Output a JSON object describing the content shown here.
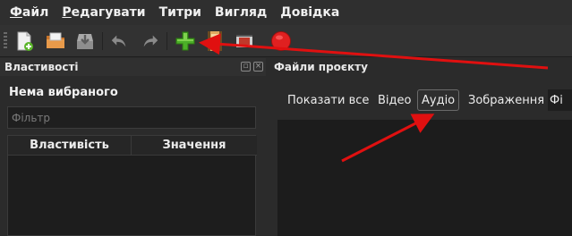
{
  "menubar": {
    "items": [
      {
        "accel": "Ф",
        "rest": "айл"
      },
      {
        "accel": "Р",
        "rest": "едагувати"
      },
      {
        "accel": "",
        "rest": "Титри"
      },
      {
        "accel": "",
        "rest": "Вигляд"
      },
      {
        "accel": "",
        "rest": "Довідка"
      }
    ]
  },
  "toolbar": {
    "icons": [
      "new-file-icon",
      "open-folder-icon",
      "save-icon",
      "undo-icon",
      "redo-icon",
      "import-files-icon",
      "film-strip-icon",
      "export-video-icon",
      "record-icon"
    ]
  },
  "properties": {
    "title": "Властивості",
    "none_selected": "Нема вибраного",
    "filter_placeholder": "Фільтр",
    "col_property": "Властивість",
    "col_value": "Значення"
  },
  "project_files": {
    "title": "Файли проєкту",
    "tabs": [
      "Показати все",
      "Відео",
      "Аудіо",
      "Зображення",
      "Фі"
    ],
    "active_tab": "Аудіо"
  },
  "colors": {
    "accent_green": "#4caf28",
    "record_red": "#e02020",
    "annotation_red": "#e01010"
  }
}
